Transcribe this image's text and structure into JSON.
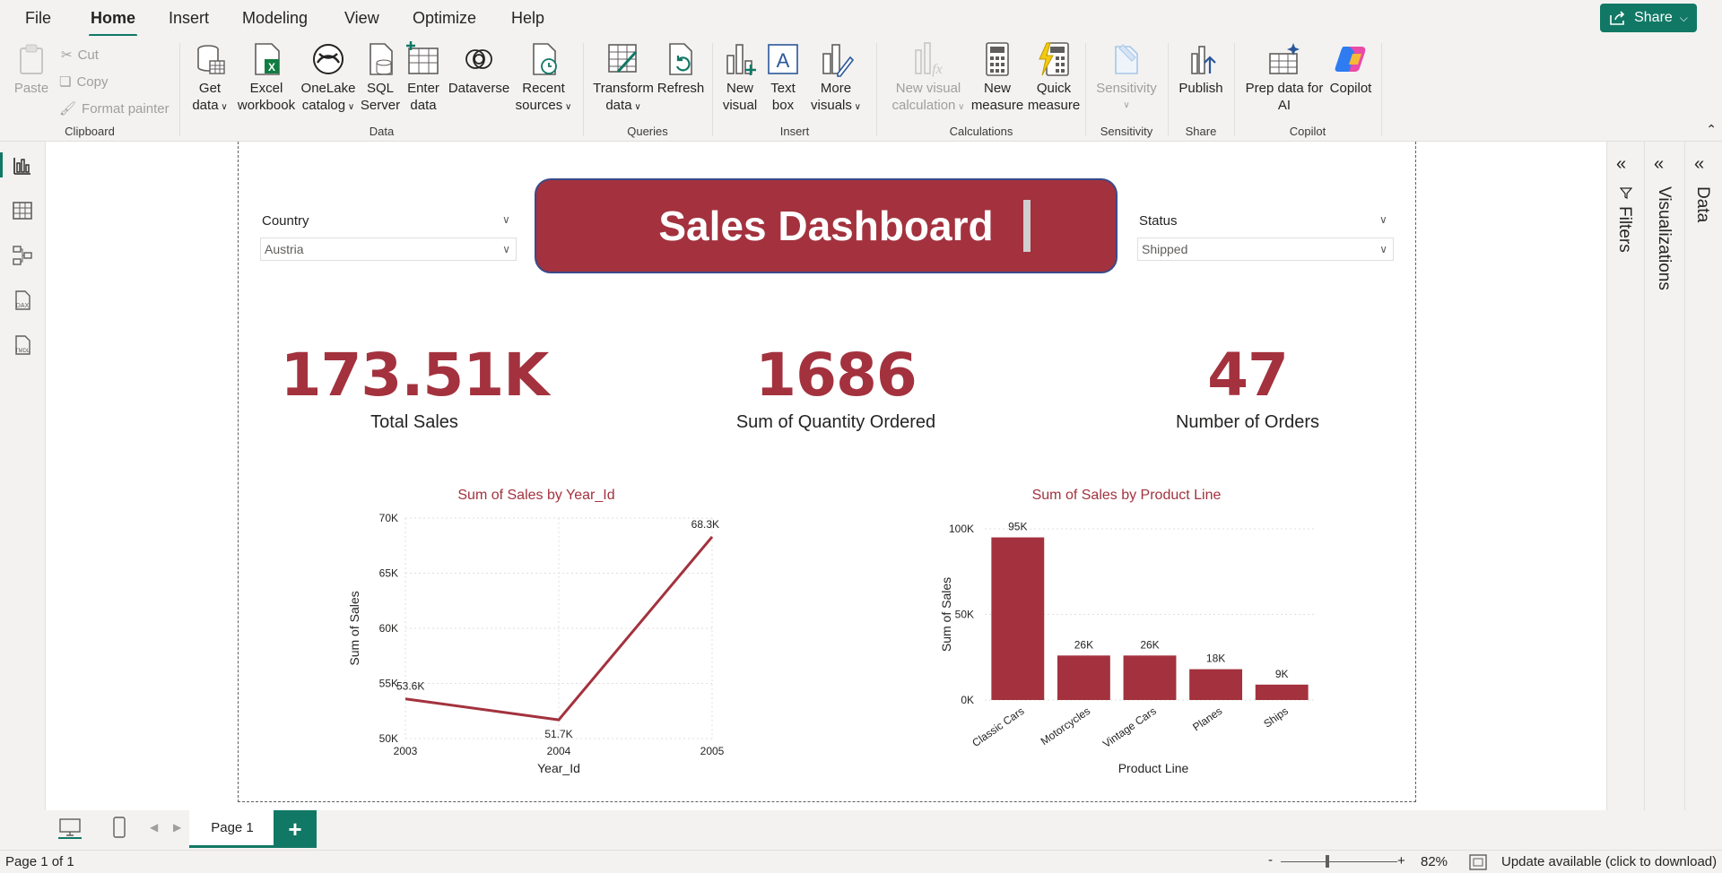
{
  "menu": {
    "file": "File",
    "home": "Home",
    "insert": "Insert",
    "modeling": "Modeling",
    "view": "View",
    "optimize": "Optimize",
    "help": "Help",
    "share": "Share"
  },
  "ribbon": {
    "clipboard": {
      "paste": "Paste",
      "cut": "Cut",
      "copy": "Copy",
      "format_painter": "Format painter",
      "label": "Clipboard"
    },
    "data": {
      "get_data": [
        "Get",
        "data"
      ],
      "excel": [
        "Excel",
        "workbook"
      ],
      "onelake": [
        "OneLake",
        "catalog"
      ],
      "sql": [
        "SQL",
        "Server"
      ],
      "enter": [
        "Enter",
        "data"
      ],
      "dataverse": "Dataverse",
      "recent": [
        "Recent",
        "sources"
      ],
      "label": "Data"
    },
    "queries": {
      "transform": [
        "Transform",
        "data"
      ],
      "refresh": "Refresh",
      "label": "Queries"
    },
    "insert": {
      "new_visual": [
        "New",
        "visual"
      ],
      "text_box": [
        "Text",
        "box"
      ],
      "more_visuals": [
        "More",
        "visuals"
      ],
      "label": "Insert"
    },
    "calculations": {
      "new_visual_calc": [
        "New visual",
        "calculation"
      ],
      "new_measure": [
        "New",
        "measure"
      ],
      "quick_measure": [
        "Quick",
        "measure"
      ],
      "label": "Calculations"
    },
    "sensitivity": {
      "sensitivity": "Sensitivity",
      "label": "Sensitivity"
    },
    "share": {
      "publish": "Publish",
      "label": "Share"
    },
    "copilot": {
      "prep": [
        "Prep data for",
        "AI"
      ],
      "copilot": "Copilot",
      "label": "Copilot"
    }
  },
  "report": {
    "country": {
      "label": "Country",
      "value": "Austria"
    },
    "status": {
      "label": "Status",
      "value": "Shipped"
    },
    "title": "Sales Dashboard",
    "kpis": [
      {
        "value": "173.51K",
        "label": "Total Sales"
      },
      {
        "value": "1686",
        "label": "Sum of Quantity Ordered"
      },
      {
        "value": "47",
        "label": "Number of Orders"
      }
    ]
  },
  "chart_data": [
    {
      "type": "line",
      "title": "Sum of Sales by Year_Id",
      "xlabel": "Year_Id",
      "ylabel": "Sum of Sales",
      "x": [
        "2003",
        "2004",
        "2005"
      ],
      "series": [
        {
          "values": [
            53600,
            51700,
            68300
          ]
        }
      ],
      "data_labels": [
        "53.6K",
        "51.7K",
        "68.3K"
      ],
      "yticks": [
        "50K",
        "55K",
        "60K",
        "65K",
        "70K"
      ],
      "ylim": [
        50000,
        70000
      ],
      "grid": true,
      "color": "#a3323e"
    },
    {
      "type": "bar",
      "title": "Sum of Sales by Product Line",
      "xlabel": "Product Line",
      "ylabel": "Sum of Sales",
      "categories": [
        "Classic Cars",
        "Motorcycles",
        "Vintage Cars",
        "Planes",
        "Ships"
      ],
      "values": [
        95000,
        26000,
        26000,
        18000,
        9000
      ],
      "data_labels": [
        "95K",
        "26K",
        "26K",
        "18K",
        "9K"
      ],
      "yticks": [
        "0K",
        "50K",
        "100K"
      ],
      "ylim": [
        0,
        100000
      ],
      "grid": true,
      "color": "#a3323e"
    }
  ],
  "panes": {
    "filters": "Filters",
    "visualizations": "Visualizations",
    "data": "Data"
  },
  "pages": {
    "tab": "Page 1",
    "add": "+"
  },
  "status": {
    "page": "Page 1 of 1",
    "zoom": "82%",
    "update": "Update available (click to download)",
    "minus": "-",
    "plus": "+"
  },
  "colors": {
    "accent": "#117865",
    "brand": "#a3323e"
  }
}
